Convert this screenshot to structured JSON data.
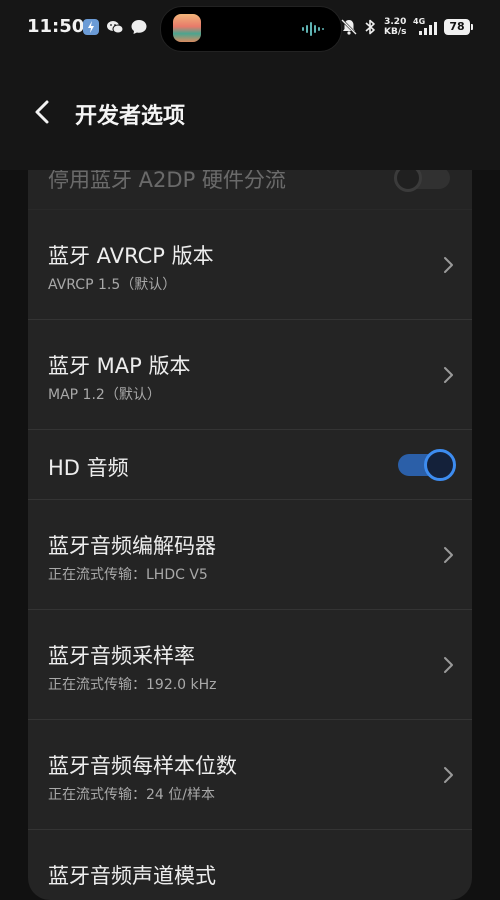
{
  "status_bar": {
    "time": "11:50",
    "network_speed_value": "3.20",
    "network_speed_unit": "KB/s",
    "signal_type": "4G",
    "battery": "78"
  },
  "header": {
    "title": "开发者选项"
  },
  "settings": [
    {
      "label": "停用蓝牙 A2DP 硬件分流",
      "type": "toggle",
      "on": false
    },
    {
      "label": "蓝牙 AVRCP 版本",
      "sub": "AVRCP 1.5（默认）",
      "type": "link"
    },
    {
      "label": "蓝牙 MAP 版本",
      "sub": "MAP 1.2（默认）",
      "type": "link"
    },
    {
      "label": "HD 音频",
      "type": "toggle",
      "on": true
    },
    {
      "label": "蓝牙音频编解码器",
      "sub": "正在流式传输：LHDC V5",
      "type": "link"
    },
    {
      "label": "蓝牙音频采样率",
      "sub": "正在流式传输：192.0 kHz",
      "type": "link"
    },
    {
      "label": "蓝牙音频每样本位数",
      "sub": "正在流式传输：24 位/样本",
      "type": "link"
    },
    {
      "label": "蓝牙音频声道模式",
      "type": "link"
    }
  ],
  "colors": {
    "accent": "#3d8cf0",
    "card": "#242424",
    "background": "#111111"
  },
  "icons": {
    "back": "chevron-left-icon",
    "row_link": "chevron-right-icon"
  }
}
